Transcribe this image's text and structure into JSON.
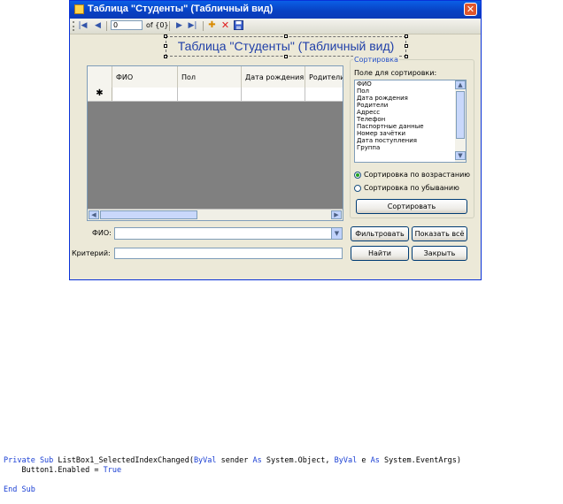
{
  "window": {
    "title": "Таблица \"Студенты\" (Табличный вид)",
    "close_glyph": "✕"
  },
  "navigator": {
    "position_value": "0",
    "count_text": "of {0}"
  },
  "form": {
    "heading": "Таблица \"Студенты\" (Табличный вид)"
  },
  "grid": {
    "columns": [
      "ФИО",
      "Пол",
      "Дата рождения",
      "Родители"
    ],
    "new_row_marker": "✱"
  },
  "sort": {
    "group_title": "Сортировка",
    "field_label": "Поле для сортировки:",
    "fields": [
      "ФИО",
      "Пол",
      "Дата рождения",
      "Родители",
      "Адресс",
      "Телефон",
      "Паспортные данные",
      "Номер зачётки",
      "Дата поступления",
      "Группа"
    ],
    "asc_label": "Сортировка по возрастанию",
    "desc_label": "Сортировка по убыванию",
    "selected": "asc",
    "sort_button": "Сортировать"
  },
  "filter": {
    "fio_label": "ФИО:",
    "criteria_label": "Критерий:",
    "filter_button": "Фильтровать",
    "show_all_button": "Показать всё",
    "find_button": "Найти",
    "close_button": "Закрыть"
  },
  "code": {
    "line1_kw1": "Private Sub",
    "line1_a": " ListBox1_SelectedIndexChanged(",
    "line1_kw2": "ByVal",
    "line1_b": " sender ",
    "line1_kw3": "As",
    "line1_c": " System.Object, ",
    "line1_kw4": "ByVal",
    "line1_d": " e ",
    "line1_kw5": "As",
    "line1_e": " System.EventArgs)",
    "line2_a": "    Button1.Enabled = ",
    "line2_kw": "True",
    "line3": "End Sub"
  },
  "colors": {
    "titlebar": "#0842c4",
    "form_heading": "#1f3fa8",
    "keyword": "#1a3fd4",
    "grid_background": "#808080"
  }
}
